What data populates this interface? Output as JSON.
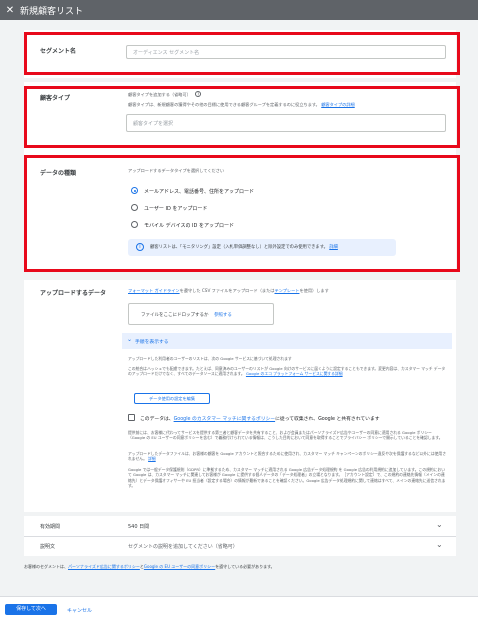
{
  "window": {
    "close_glyph": "✕",
    "title": "新規顧客リスト"
  },
  "segment": {
    "label": "セグメント名",
    "placeholder": "オーディエンス セグメント名"
  },
  "customer_type": {
    "label": "顧客タイプ",
    "subtitle": "顧客タイプを追加する（省略可）",
    "help_icon": "?",
    "description": "顧客タイプは、新規顧客の獲得やその他の目標に使用できる顧客グループを定義するのに役立ちます。",
    "description_link": "顧客タイプの詳細",
    "select_placeholder": "顧客タイプを選択"
  },
  "data_type": {
    "label": "データの種類",
    "prompt": "アップロードするデータタイプを選択してください",
    "options": [
      {
        "label": "メールアドレス、電話番号、住所をアップロード",
        "selected": true
      },
      {
        "label": "ユーザー ID をアップロード",
        "selected": false
      },
      {
        "label": "モバイル デバイスの ID をアップロード",
        "selected": false
      }
    ],
    "info_icon": "i",
    "info_text": "顧客リストは、「モニタリング」設定（入札単価調整なし）と除外設定でのみ使用できます。",
    "info_link": "詳細"
  },
  "upload": {
    "label": "アップロードするデータ",
    "desc_link1": "フォーマット ガイドライン",
    "desc_mid": "を遵守した CSV ファイルをアップロード（または",
    "desc_link2": "テンプレート",
    "desc_end": "を使用）します",
    "drop_text": "ファイルをここにドロップするか",
    "browse_link": "参照する",
    "steps_label": "手順を表示する",
    "hash_title": "アップロードした利用者のユーザーのリストは、次の Google サービスに基づいて処理されます",
    "hash_text": "この統合はハッシュでも配慮できます。たとえば、同意済みのユーザーのリストが Google 向けのサービスに届くように設定することもできます。変更内容は、カスタマー マッチ データのアップロードだけでなく、すべてのデータソースに適用されます。",
    "hash_link": "Google のエコ プラットフォーム サービスに関する詳細",
    "data_settings_button": "データ使用の設定を編集",
    "consent_prefix": "このデータは、",
    "consent_link": "Google のカスタマー マッチに関するポリシー",
    "consent_suffix": "に従って収集され、Google と共有されています",
    "para1": "提供前には、お客様に代わってサービスを提供する第三者と顧客データを共有すること、および会員またはパーソナライズド広告やユーザーの同意に適用される Google ポリシー（Google の EU ユーザーの同意ポリシーを含む）で義務付けられている情報は、こうした目的において同意を取得することでプライバシー ポリシーで開示していることを確認します。",
    "para2": "アップロードしたデータファイルは、お客様の顧客を Google アカウントと照合するために使用され、カスタマー マッチ キャンペーンのポリシー違反や次を保護するなど以外には使用されません。",
    "para2_link": "詳細",
    "para3": "Google では一般データ保護規則（GDPR）に準拠するため、カスタマー マッチに適用される Google 広告データ処理規約 を Google 広告の利用規約に追加しています。この規約において Google は、カスタマー マッチに関連してお客様が Google に提供する個人データの「データ処理者」の立場となります。［アカウント設定］で、この規約の連絡先情報（メインの連絡先）とデータ保護オフィサーや EU 担当者（設定する場合）の情報が最新であることを確認ください。Google 広告データ処理規約に関して連絡はすべて、メインの連絡先に送信されます。"
  },
  "expiry": {
    "label": "有効期間",
    "value": "540 日間"
  },
  "description_row": {
    "label": "説明文",
    "value": "セグメントの説明を追加してください（省略可）"
  },
  "footer_note": {
    "prefix": "お客様のセグメントは、",
    "link1": "パーソナライズド広告に関するポリシー",
    "mid": "と",
    "link2": "Google の EU ユーザーの同意ポリシー",
    "suffix": "を遵守している必要があります。"
  },
  "actions": {
    "primary": "保存して次へ",
    "cancel": "キャンセル"
  },
  "colors": {
    "accent": "#1a73e8",
    "highlight_border": "#e8091b",
    "topbar": "#5f6368"
  }
}
